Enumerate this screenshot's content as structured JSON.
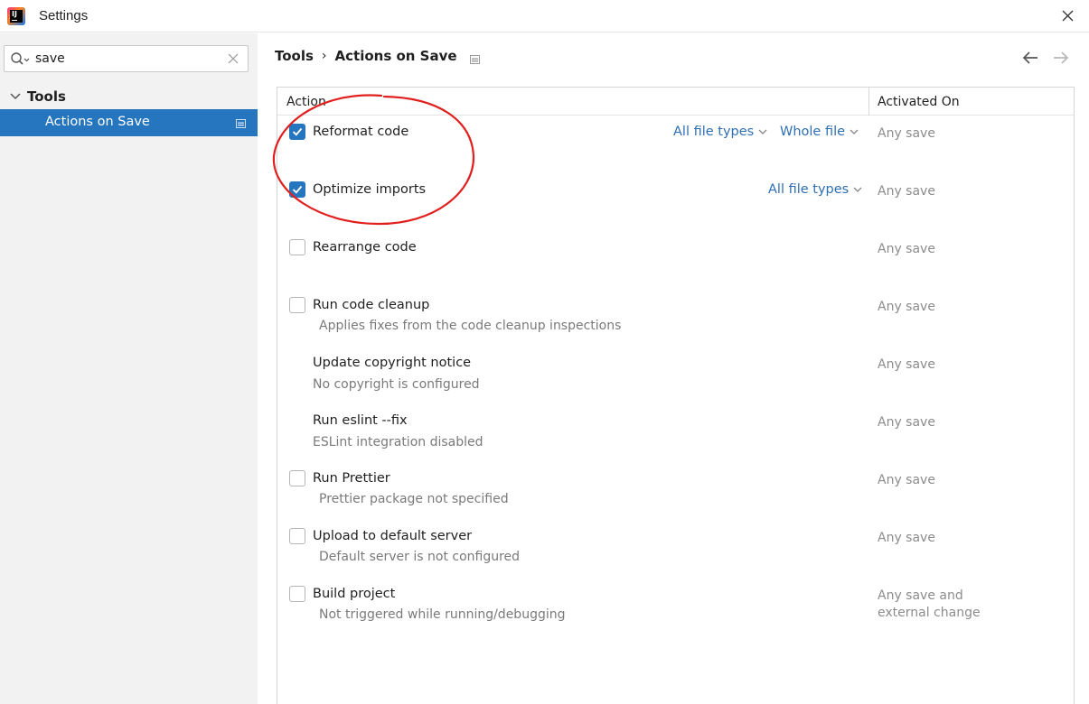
{
  "window": {
    "title": "Settings"
  },
  "search": {
    "value": "save"
  },
  "tree": {
    "group_label": "Tools",
    "selected_item": "Actions on Save"
  },
  "breadcrumb": {
    "parent": "Tools",
    "separator": "›",
    "current": "Actions on Save"
  },
  "table": {
    "col_action": "Action",
    "col_activated": "Activated On",
    "rows": [
      {
        "label": "Reformat code",
        "checked": true,
        "dropdown1": "All file types",
        "dropdown2": "Whole file",
        "activated": "Any save"
      },
      {
        "label": "Optimize imports",
        "checked": true,
        "dropdown1": "All file types",
        "activated": "Any save"
      },
      {
        "label": "Rearrange code",
        "checked": false,
        "activated": "Any save"
      },
      {
        "label": "Run code cleanup",
        "checked": false,
        "desc": "Applies fixes from the code cleanup inspections",
        "activated": "Any save"
      },
      {
        "label": "Update copyright notice",
        "desc": "No copyright is configured",
        "activated": "Any save"
      },
      {
        "label": "Run eslint --fix",
        "desc": "ESLint integration disabled",
        "activated": "Any save"
      },
      {
        "label": "Run Prettier",
        "checked": false,
        "desc": "Prettier package not specified",
        "activated": "Any save"
      },
      {
        "label": "Upload to default server",
        "checked": false,
        "desc": "Default server is not configured",
        "activated": "Any save"
      },
      {
        "label": "Build project",
        "checked": false,
        "desc": "Not triggered while running/debugging",
        "activated": "Any save and external change"
      }
    ]
  },
  "icons": {
    "app": "intellij-icon",
    "close": "close-icon",
    "search": "search-icon",
    "clear": "clear-icon",
    "back": "arrow-left-icon",
    "forward": "arrow-right-icon"
  },
  "colors": {
    "accent": "#2675bf",
    "link": "#2f6fb4",
    "annotation": "#e0201f",
    "sidebar_bg": "#f2f2f2"
  }
}
